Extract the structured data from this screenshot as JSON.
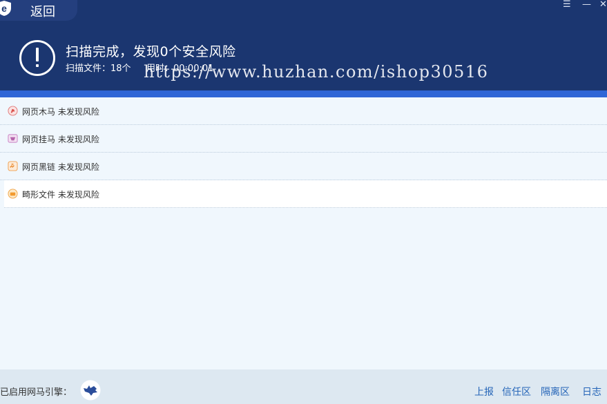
{
  "header": {
    "back_label": "返回",
    "title": "扫描完成，发现0个安全风险",
    "scanned_files": "扫描文件：18个",
    "elapsed": "用时：00:00:01",
    "watermark": "https://www.huzhan.com/ishop30516",
    "controls": {
      "menu": "☰",
      "minimize": "—",
      "close": "✕"
    }
  },
  "results": [
    {
      "icon": "trojan-icon",
      "label": "网页木马 未发现风险",
      "selected": false
    },
    {
      "icon": "hook-icon",
      "label": "网页挂马 未发现风险",
      "selected": false
    },
    {
      "icon": "dark-link-icon",
      "label": "网页黑链 未发现风险",
      "selected": false
    },
    {
      "icon": "abnormal-file-icon",
      "label": "畸形文件 未发现风险",
      "selected": true
    }
  ],
  "footer": {
    "engine_label": "已启用网马引擎：",
    "links": {
      "report": "上报",
      "trust": "信任区",
      "quarantine": "隔离区",
      "log": "日志"
    }
  },
  "colors": {
    "header_bg": "#1b3670",
    "accent_bar": "#2f66d6",
    "content_bg": "#f0f7fd",
    "footer_bg": "#dde8f1",
    "link": "#2565b8"
  }
}
